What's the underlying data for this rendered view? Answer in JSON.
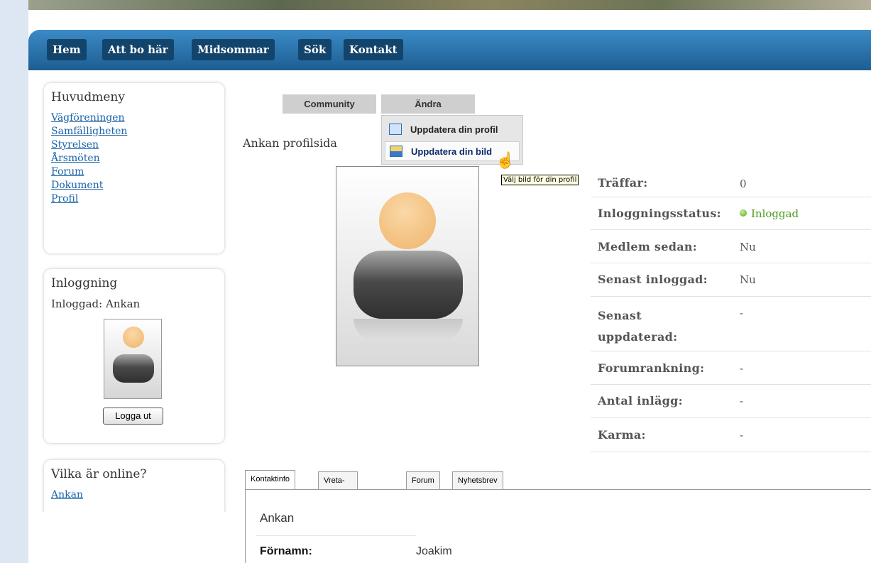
{
  "nav": {
    "items": [
      "Hem",
      "Att bo här",
      "Midsommar",
      "Sök",
      "Kontakt"
    ]
  },
  "sidebar": {
    "main_menu": {
      "title": "Huvudmeny",
      "links": [
        "Vägföreningen",
        "Samfälligheten",
        "Styrelsen",
        "Årsmöten",
        "Forum",
        "Dokument",
        "Profil"
      ]
    },
    "login": {
      "title": "Inloggning",
      "status": "Inloggad: Ankan",
      "logout_label": "Logga ut"
    },
    "online": {
      "title": "Vilka är online?",
      "users": [
        "Ankan"
      ]
    }
  },
  "toolbar": {
    "tabs": [
      "Community",
      "Ändra"
    ],
    "dropdown": {
      "items": [
        {
          "label": "Uppdatera din profil",
          "icon": "profile-card-icon"
        },
        {
          "label": "Uppdatera din bild",
          "icon": "picture-icon"
        }
      ],
      "tooltip": "Välj bild för din profil"
    }
  },
  "profile": {
    "title": "Ankan profilsida",
    "rows": [
      {
        "label": "Träffar:",
        "value": "0"
      },
      {
        "label": "Inloggningsstatus:",
        "value": "Inloggad",
        "online": true
      },
      {
        "label": "Medlem sedan:",
        "value": "Nu"
      },
      {
        "label": "Senast inloggad:",
        "value": "Nu"
      },
      {
        "label": "Senast uppdaterad:",
        "value": "-"
      },
      {
        "label": "Forumrankning:",
        "value": "-"
      },
      {
        "label": "Antal inlägg:",
        "value": "-"
      },
      {
        "label": "Karma:",
        "value": "-"
      }
    ]
  },
  "details": {
    "tabs": [
      "Kontaktinfo",
      "Vreta-Yttemäs",
      "Forum",
      "Nyhetsbrev"
    ],
    "name": "Ankan",
    "fields": [
      {
        "label": "Förnamn:",
        "value": "Joakim"
      }
    ]
  },
  "colors": {
    "nav_bar": "#1d5e93",
    "nav_button": "#13446b",
    "link": "#1a63a8",
    "online_green": "#4fa21b"
  }
}
